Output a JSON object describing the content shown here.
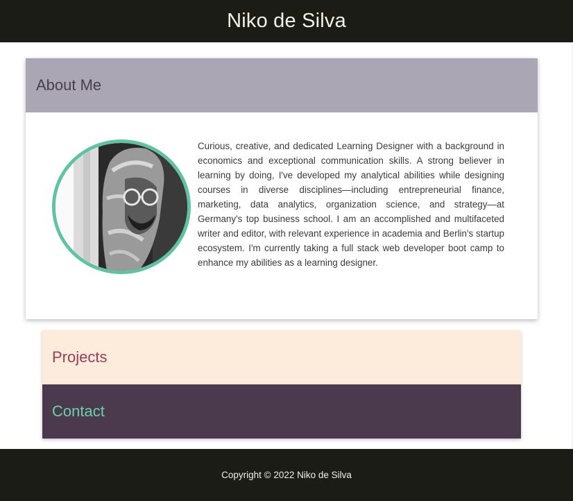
{
  "header": {
    "title": "Niko de Silva"
  },
  "about": {
    "heading": "About Me",
    "photo": {
      "icon": "portrait-photo",
      "accent_color": "#5ec4a0"
    },
    "bio": "Curious, creative, and dedicated Learning Designer with a background in economics and exceptional communication skills. A strong believer in learning by doing, I've developed my analytical abilities while designing courses in diverse disciplines—including entrepreneurial finance, marketing, data analytics, organization science, and strategy—at Germany's top business school. I am an accomplished and multifaceted writer and editor, with relevant experience in academia and Berlin's startup ecosystem. I'm currently taking a full stack web developer boot camp to enhance my abilities as a learning designer."
  },
  "projects": {
    "heading": "Projects"
  },
  "contact": {
    "heading": "Contact"
  },
  "footer": {
    "copyright": "Copyright © 2022 Niko de Silva"
  },
  "colors": {
    "header_bg": "#1c1c17",
    "about_header_bg": "#aaa6b4",
    "projects_bg": "#fdecdb",
    "projects_text": "#9b3b55",
    "contact_bg": "#4b3a4e",
    "contact_text": "#6cd0a8"
  }
}
